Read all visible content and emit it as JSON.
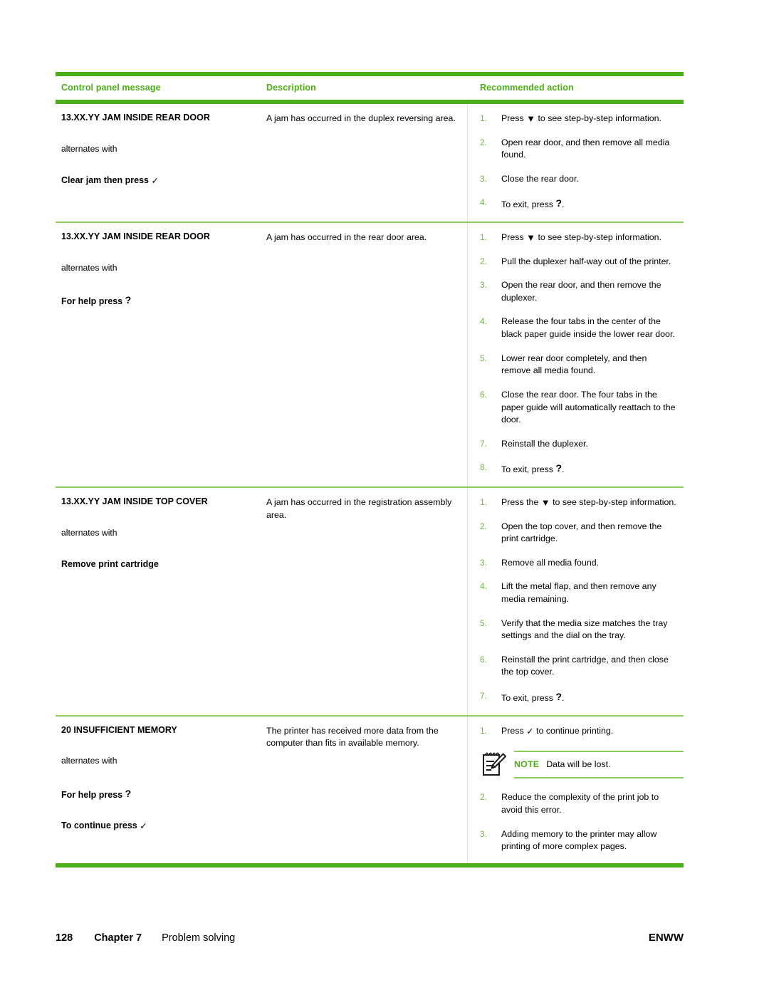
{
  "document": {
    "page_number": "128",
    "chapter": "Chapter 7",
    "section_title": "Problem solving",
    "footer_right": "ENWW"
  },
  "colors": {
    "accent_green": "#4caf17",
    "rule_light_green": "#8ccc5a",
    "step_number_green": "#6cbf3a"
  },
  "table": {
    "headers": {
      "col1": "Control panel message",
      "col2": "Description",
      "col3": "Recommended action"
    },
    "rows": [
      {
        "message_title": "13.XX.YY JAM INSIDE REAR DOOR",
        "alternates_label": "alternates with",
        "message_alt": "Clear jam then press",
        "message_alt_glyph": "check",
        "description": "A jam has occurred in the duplex reversing area.",
        "steps": [
          {
            "num": "1.",
            "pre": "Press ",
            "glyph": "down",
            "post": " to see step-by-step information."
          },
          {
            "num": "2.",
            "pre": "Open rear door, and then remove all media found.",
            "glyph": "",
            "post": ""
          },
          {
            "num": "3.",
            "pre": "Close the rear door.",
            "glyph": "",
            "post": ""
          },
          {
            "num": "4.",
            "pre": "To exit, press ",
            "glyph": "question",
            "post": "."
          }
        ]
      },
      {
        "message_title": "13.XX.YY JAM INSIDE REAR DOOR",
        "alternates_label": "alternates with",
        "message_alt": "For help press",
        "message_alt_glyph": "question",
        "description": "A jam has occurred in the rear door area.",
        "steps": [
          {
            "num": "1.",
            "pre": "Press ",
            "glyph": "down",
            "post": " to see step-by-step information."
          },
          {
            "num": "2.",
            "pre": "Pull the duplexer half-way out of the printer.",
            "glyph": "",
            "post": ""
          },
          {
            "num": "3.",
            "pre": "Open the rear door, and then remove the duplexer.",
            "glyph": "",
            "post": ""
          },
          {
            "num": "4.",
            "pre": "Release the four tabs in the center of the black paper guide inside the lower rear door.",
            "glyph": "",
            "post": ""
          },
          {
            "num": "5.",
            "pre": "Lower rear door completely, and then remove all media found.",
            "glyph": "",
            "post": ""
          },
          {
            "num": "6.",
            "pre": "Close the rear door. The four tabs in the paper guide will automatically reattach to the door.",
            "glyph": "",
            "post": ""
          },
          {
            "num": "7.",
            "pre": "Reinstall the duplexer.",
            "glyph": "",
            "post": ""
          },
          {
            "num": "8.",
            "pre": "To exit, press ",
            "glyph": "question",
            "post": "."
          }
        ]
      },
      {
        "message_title": "13.XX.YY JAM INSIDE TOP COVER",
        "alternates_label": "alternates with",
        "message_alt": "Remove print cartridge",
        "message_alt_glyph": "",
        "description": "A jam has occurred in the registration assembly area.",
        "steps": [
          {
            "num": "1.",
            "pre": "Press the ",
            "glyph": "down",
            "post": " to see step-by-step information."
          },
          {
            "num": "2.",
            "pre": "Open the top cover, and then remove the print cartridge.",
            "glyph": "",
            "post": ""
          },
          {
            "num": "3.",
            "pre": "Remove all media found.",
            "glyph": "",
            "post": ""
          },
          {
            "num": "4.",
            "pre": "Lift the metal flap, and then remove any media remaining.",
            "glyph": "",
            "post": ""
          },
          {
            "num": "5.",
            "pre": "Verify that the media size matches the tray settings and the dial on the tray.",
            "glyph": "",
            "post": ""
          },
          {
            "num": "6.",
            "pre": "Reinstall the print cartridge, and then close the top cover.",
            "glyph": "",
            "post": ""
          },
          {
            "num": "7.",
            "pre": "To exit, press ",
            "glyph": "question",
            "post": "."
          }
        ]
      },
      {
        "message_title": "20 INSUFFICIENT MEMORY",
        "alternates_label": "alternates with",
        "message_alt": "For help press",
        "message_alt_glyph": "question",
        "message_alt2": "To continue press",
        "message_alt2_glyph": "check",
        "description": "The printer has received more data from the computer than fits in available memory.",
        "steps": [
          {
            "num": "1.",
            "pre": "Press ",
            "glyph": "check",
            "post": " to continue printing."
          },
          {
            "num": "2.",
            "pre": "Reduce the complexity of the print job to avoid this error.",
            "glyph": "",
            "post": ""
          },
          {
            "num": "3.",
            "pre": "Adding memory to the printer may allow printing of more complex pages.",
            "glyph": "",
            "post": ""
          }
        ],
        "note": {
          "label": "NOTE",
          "text": "Data will be lost.",
          "icon": "notepad-pencil-icon"
        }
      }
    ]
  },
  "glyphs": {
    "check": "✓",
    "down": "▼",
    "question": "?"
  }
}
